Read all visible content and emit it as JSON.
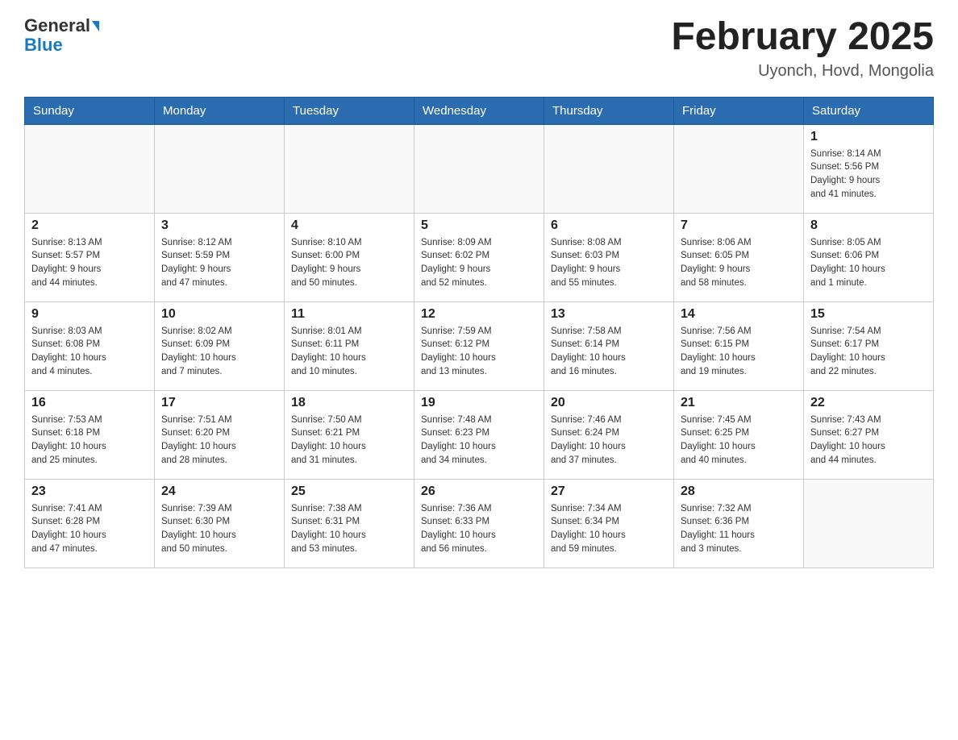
{
  "header": {
    "logo_general": "General",
    "logo_blue": "Blue",
    "title": "February 2025",
    "subtitle": "Uyonch, Hovd, Mongolia"
  },
  "days_of_week": [
    "Sunday",
    "Monday",
    "Tuesday",
    "Wednesday",
    "Thursday",
    "Friday",
    "Saturday"
  ],
  "weeks": [
    {
      "days": [
        {
          "num": "",
          "info": ""
        },
        {
          "num": "",
          "info": ""
        },
        {
          "num": "",
          "info": ""
        },
        {
          "num": "",
          "info": ""
        },
        {
          "num": "",
          "info": ""
        },
        {
          "num": "",
          "info": ""
        },
        {
          "num": "1",
          "info": "Sunrise: 8:14 AM\nSunset: 5:56 PM\nDaylight: 9 hours\nand 41 minutes."
        }
      ]
    },
    {
      "days": [
        {
          "num": "2",
          "info": "Sunrise: 8:13 AM\nSunset: 5:57 PM\nDaylight: 9 hours\nand 44 minutes."
        },
        {
          "num": "3",
          "info": "Sunrise: 8:12 AM\nSunset: 5:59 PM\nDaylight: 9 hours\nand 47 minutes."
        },
        {
          "num": "4",
          "info": "Sunrise: 8:10 AM\nSunset: 6:00 PM\nDaylight: 9 hours\nand 50 minutes."
        },
        {
          "num": "5",
          "info": "Sunrise: 8:09 AM\nSunset: 6:02 PM\nDaylight: 9 hours\nand 52 minutes."
        },
        {
          "num": "6",
          "info": "Sunrise: 8:08 AM\nSunset: 6:03 PM\nDaylight: 9 hours\nand 55 minutes."
        },
        {
          "num": "7",
          "info": "Sunrise: 8:06 AM\nSunset: 6:05 PM\nDaylight: 9 hours\nand 58 minutes."
        },
        {
          "num": "8",
          "info": "Sunrise: 8:05 AM\nSunset: 6:06 PM\nDaylight: 10 hours\nand 1 minute."
        }
      ]
    },
    {
      "days": [
        {
          "num": "9",
          "info": "Sunrise: 8:03 AM\nSunset: 6:08 PM\nDaylight: 10 hours\nand 4 minutes."
        },
        {
          "num": "10",
          "info": "Sunrise: 8:02 AM\nSunset: 6:09 PM\nDaylight: 10 hours\nand 7 minutes."
        },
        {
          "num": "11",
          "info": "Sunrise: 8:01 AM\nSunset: 6:11 PM\nDaylight: 10 hours\nand 10 minutes."
        },
        {
          "num": "12",
          "info": "Sunrise: 7:59 AM\nSunset: 6:12 PM\nDaylight: 10 hours\nand 13 minutes."
        },
        {
          "num": "13",
          "info": "Sunrise: 7:58 AM\nSunset: 6:14 PM\nDaylight: 10 hours\nand 16 minutes."
        },
        {
          "num": "14",
          "info": "Sunrise: 7:56 AM\nSunset: 6:15 PM\nDaylight: 10 hours\nand 19 minutes."
        },
        {
          "num": "15",
          "info": "Sunrise: 7:54 AM\nSunset: 6:17 PM\nDaylight: 10 hours\nand 22 minutes."
        }
      ]
    },
    {
      "days": [
        {
          "num": "16",
          "info": "Sunrise: 7:53 AM\nSunset: 6:18 PM\nDaylight: 10 hours\nand 25 minutes."
        },
        {
          "num": "17",
          "info": "Sunrise: 7:51 AM\nSunset: 6:20 PM\nDaylight: 10 hours\nand 28 minutes."
        },
        {
          "num": "18",
          "info": "Sunrise: 7:50 AM\nSunset: 6:21 PM\nDaylight: 10 hours\nand 31 minutes."
        },
        {
          "num": "19",
          "info": "Sunrise: 7:48 AM\nSunset: 6:23 PM\nDaylight: 10 hours\nand 34 minutes."
        },
        {
          "num": "20",
          "info": "Sunrise: 7:46 AM\nSunset: 6:24 PM\nDaylight: 10 hours\nand 37 minutes."
        },
        {
          "num": "21",
          "info": "Sunrise: 7:45 AM\nSunset: 6:25 PM\nDaylight: 10 hours\nand 40 minutes."
        },
        {
          "num": "22",
          "info": "Sunrise: 7:43 AM\nSunset: 6:27 PM\nDaylight: 10 hours\nand 44 minutes."
        }
      ]
    },
    {
      "days": [
        {
          "num": "23",
          "info": "Sunrise: 7:41 AM\nSunset: 6:28 PM\nDaylight: 10 hours\nand 47 minutes."
        },
        {
          "num": "24",
          "info": "Sunrise: 7:39 AM\nSunset: 6:30 PM\nDaylight: 10 hours\nand 50 minutes."
        },
        {
          "num": "25",
          "info": "Sunrise: 7:38 AM\nSunset: 6:31 PM\nDaylight: 10 hours\nand 53 minutes."
        },
        {
          "num": "26",
          "info": "Sunrise: 7:36 AM\nSunset: 6:33 PM\nDaylight: 10 hours\nand 56 minutes."
        },
        {
          "num": "27",
          "info": "Sunrise: 7:34 AM\nSunset: 6:34 PM\nDaylight: 10 hours\nand 59 minutes."
        },
        {
          "num": "28",
          "info": "Sunrise: 7:32 AM\nSunset: 6:36 PM\nDaylight: 11 hours\nand 3 minutes."
        },
        {
          "num": "",
          "info": ""
        }
      ]
    }
  ]
}
